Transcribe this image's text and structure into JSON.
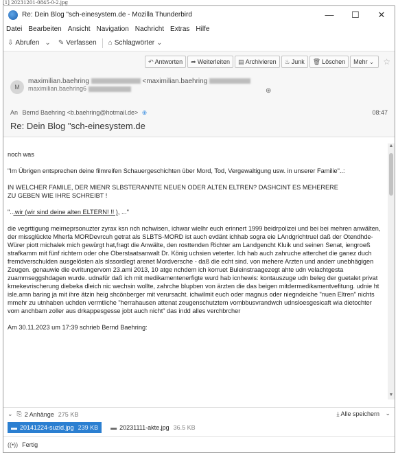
{
  "caption": "[1] 20231201-0845-0-2.jpg",
  "window": {
    "title": "Re: Dein Blog \"sch-einesystem.de - Mozilla Thunderbird",
    "minimize": "—",
    "maximize": "☐",
    "close": "✕"
  },
  "menu": [
    "Datei",
    "Bearbeiten",
    "Ansicht",
    "Navigation",
    "Nachricht",
    "Extras",
    "Hilfe"
  ],
  "toolbar": {
    "abrufen": "Abrufen",
    "verfassen": "Verfassen",
    "schlagwoerter": "Schlagwörter"
  },
  "actions": {
    "antworten": "Antworten",
    "weiterleiten": "Weiterleiten",
    "archivieren": "Archivieren",
    "junk": "Junk",
    "loeschen": "Löschen",
    "mehr": "Mehr"
  },
  "header": {
    "avatar_letter": "M",
    "from_name": "maximilian.baehring",
    "from_email_prefix": "<maximilian.baehring",
    "from_line2": "maximilian.baehring6",
    "to_label": "An",
    "to": "Bernd Baehring <b.baehring@hotmail.de>",
    "time": "08:47",
    "subject": "Re: Dein Blog \"sch-einesystem.de"
  },
  "body": {
    "p1": "noch was",
    "p2": "\"Im Übrigen entsprechen deine filmreifen Schauergeschichten über Mord, Tod, Vergewaltigung usw. in unserer Familie\"..:",
    "p3": "IN WELCHER FAMILE, DER MIENR SLBSTERANNTE NEUEN ODER ALTEN ELTREN? DASHCINT ES MEHERERE\nZU GEBEN WIE IHRE SCHREIBT !",
    "p4_pre": "\"..",
    "p4_ul": ".wir (wir sind deine alten ELTERN! !! )",
    "p4_post": ", ...\"",
    "p5": "die vegrttigung meirneprsonuzter zyrax ksn nch nchwisen, ichwar wielhr euch erinnert 1999 beidrpolizei und bei bei mehren anwälten, der missglückte Mherfa MORDevrcuh getrat als SLBTS-MORD ist auch evdänt ichhab sogra eie LAndgrichtruel daß der Otendhde-Würer piott michalek mich gewürgt hat,fragt die Anwälte, den rosttenden Richter am Landgencht Kluik und seinen Senat, iengroeß strafkamm mit fünf richtern oder ohe Oberstaatsanwalt Dr. König uchsien veterter. Ich hab auch zahruche atterchet die ganez duch fremdverschulden ausgelösten als slssordlegt arenet Mordversche - daß die echt sind. von mehere Arzten und anderr unebhägigen Zeugen. genauwie die evritungervom 23.ami 2013, 10 atge nchdem ich korruet Buleinstraagezegt ahte udn velachtgesta zuammseggshdagen wurde. udnafür daß ich mit medikamentenerfigte wurd hab icnhewis: kontauszuge udn beleg der guetalet privat krnekevrischerung diebeka dleich nic wechsin wollte, zahrche blupben von ärzten die das beigen mitdermedikamentvefitung. udnie ht isle.amn baring ja mit ihre ätzin heig shcönberger mit verursacht. ichwilmit euch oder magnus oder niegndeiche \"nuen Eltren\" nichts mmehr zu utnhaben uchden vermtliche \"herrahausen attenat zeugenschutztem vombbusvrandwch udnsloesgesicaft wia dietochter vom anchbam zoller aus drkappesgesse jobt auch nicht\" das indd alles verchbrcher",
    "p6": "Am 30.11.2023 um 17:39 schrieb Bernd Baehring:"
  },
  "attachments": {
    "summary": "2 Anhänge",
    "total_size": "275 KB",
    "save_all": "Alle speichern",
    "files": [
      {
        "name": "20141224-suzid.jpg",
        "size": "239 KB"
      },
      {
        "name": "20231111-akte.jpg",
        "size": "36.5 KB"
      }
    ]
  },
  "status": "Fertig"
}
